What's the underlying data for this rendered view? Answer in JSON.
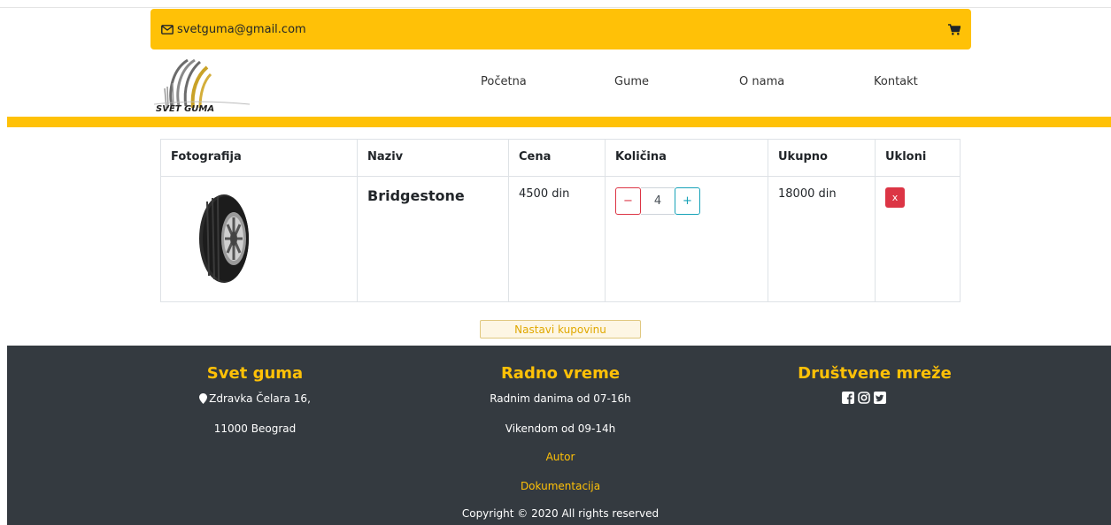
{
  "topbar": {
    "email": "svetguma@gmail.com",
    "cart_icon": "cart-icon",
    "mail_icon": "envelope-icon"
  },
  "logo": {
    "text": "SVET GUMA"
  },
  "nav": {
    "items": [
      "Početna",
      "Gume",
      "O nama",
      "Kontakt"
    ]
  },
  "cart": {
    "headers": [
      "Fotografija",
      "Naziv",
      "Cena",
      "Količina",
      "Ukupno",
      "Ukloni"
    ],
    "rows": [
      {
        "name": "Bridgestone",
        "price": "4500 din",
        "quantity": "4",
        "total": "18000 din",
        "remove": "x",
        "minus": "−",
        "plus": "+"
      }
    ]
  },
  "continue_label": "Nastavi kupovinu",
  "footer": {
    "col1": {
      "title": "Svet guma",
      "address1": "Zdravka Čelara 16,",
      "address2": "11000 Beograd"
    },
    "col2": {
      "title": "Radno vreme",
      "weekdays": "Radnim danima od 07-16h",
      "weekend": "Vikendom od 09-14h",
      "link1": "Autor",
      "link2": "Dokumentacija",
      "copyright": "Copyright © 2020 All rights reserved"
    },
    "col3": {
      "title": "Društvene mreže",
      "icons": [
        "facebook-icon",
        "instagram-icon",
        "twitter-icon"
      ]
    }
  },
  "colors": {
    "accent": "#ffc107",
    "footer_bg": "#343a40",
    "danger": "#dc3545",
    "info": "#17a2b8"
  }
}
